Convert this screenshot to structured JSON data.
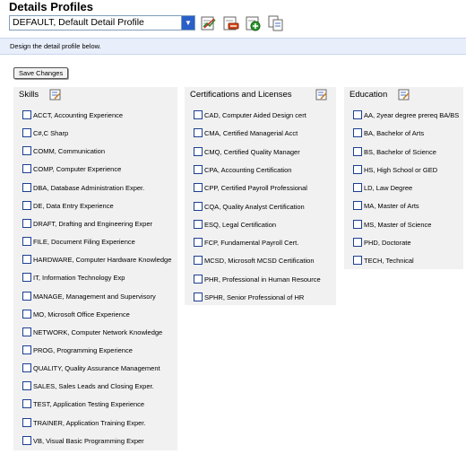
{
  "page": {
    "title": "Details Profiles",
    "profile_select": "DEFAULT, Default Detail Profile",
    "instruction": "Design the detail profile below.",
    "save_label": "Save Changes"
  },
  "toolbar_icons": [
    "edit-profile-icon",
    "delete-profile-icon",
    "add-profile-icon",
    "copy-profile-icon"
  ],
  "skills": {
    "header": "Skills",
    "items": [
      "ACCT, Accounting Experience",
      "C#,C Sharp",
      "COMM, Communication",
      "COMP, Computer Experience",
      "DBA, Database Administration Exper.",
      "DE, Data Entry Experience",
      "DRAFT, Drafting and Engineering Exper",
      "FILE, Document Filing Experience",
      "HARDWARE, Computer Hardware Knowledge",
      "IT, Information Technology Exp",
      "MANAGE, Management and Supervisory",
      "MO, Microsoft Office Experience",
      "NETWORK, Computer Network Knowledge",
      "PROG, Programming Experience",
      "QUALITY, Quality Assurance Management",
      "SALES, Sales Leads and Closing Exper.",
      "TEST, Application Testing Experience",
      "TRAINER, Application Training Exper.",
      "VB, Visual Basic Programming Exper"
    ]
  },
  "certifications": {
    "header": "Certifications and Licenses",
    "items": [
      "CAD, Computer Aided Design cert",
      "CMA, Certified Managerial Acct",
      "CMQ, Certified Quality Manager",
      "CPA, Accounting Certification",
      "CPP, Certified Payroll Professional",
      "CQA, Quality Analyst Certification",
      "ESQ, Legal Certification",
      "FCP, Fundamental Payroll Cert.",
      "MCSD, Microsoft MCSD Certification",
      "PHR, Professional in Human Resource",
      "SPHR, Senior Professional of HR"
    ]
  },
  "education": {
    "header": "Education",
    "items": [
      "AA, 2year degree prereq BA/BS",
      "BA, Bachelor of Arts",
      "BS, Bachelor of Science",
      "HS, High School or GED",
      "LD, Law Degree",
      "MA, Master of Arts",
      "MS, Master of Science",
      "PHD, Doctorate",
      "TECH, Technical"
    ]
  }
}
